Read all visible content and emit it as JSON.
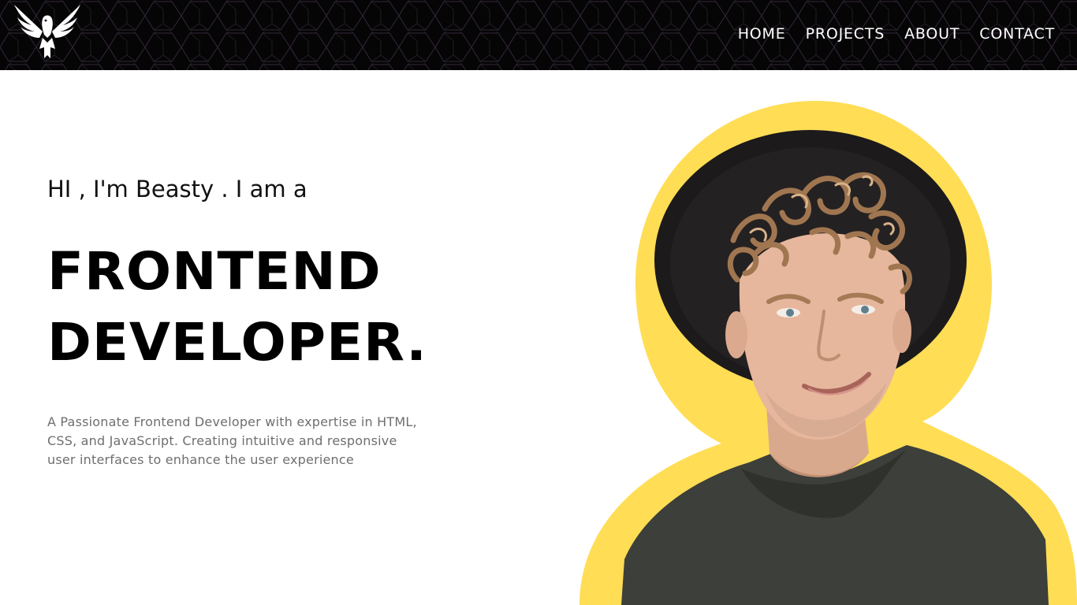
{
  "nav": {
    "items": [
      {
        "label": "HOME"
      },
      {
        "label": "PROJECTS"
      },
      {
        "label": "ABOUT"
      },
      {
        "label": "CONTACT"
      }
    ]
  },
  "hero": {
    "greeting": "HI , I'm Beasty . I am a",
    "role_line1": "FRONTEND",
    "role_line2": "DEVELOPER.",
    "description": "A Passionate Frontend Developer with expertise in HTML, CSS, and JavaScript. Creating intuitive and responsive user interfaces to enhance the user experience"
  },
  "colors": {
    "header_bg": "#050505",
    "accent_yellow": "#FFDD55",
    "text_dark": "#000000",
    "text_muted": "#6f6f6f"
  },
  "icons": {
    "logo": "phoenix-logo-icon"
  }
}
